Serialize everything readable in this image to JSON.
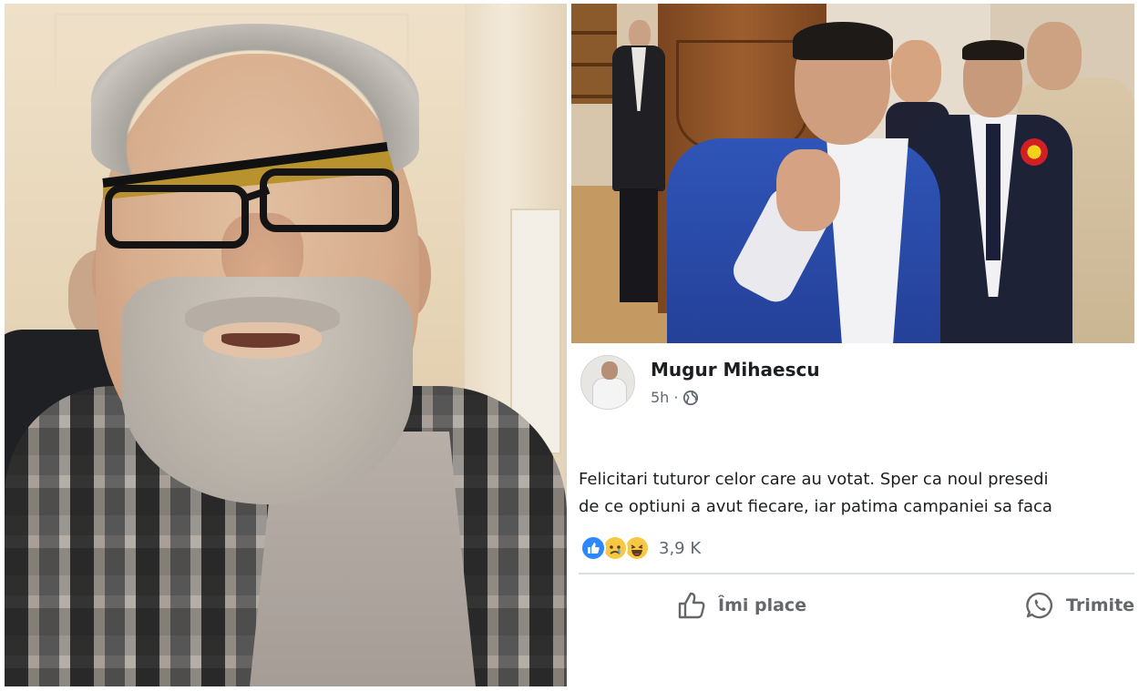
{
  "post": {
    "author": "Mugur Mihaescu",
    "time": "5h",
    "separator": "·",
    "privacy_icon": "globe-icon",
    "text_lines": [
      "Felicitari tuturor celor care au votat. Sper ca noul presedi",
      "de ce optiuni a avut fiecare, iar patima campaniei sa faca"
    ],
    "reactions": {
      "icons": [
        "like-icon",
        "sad-icon",
        "haha-icon"
      ],
      "count": "3,9 K"
    },
    "actions": {
      "like_label": "Îmi place",
      "share_label": "Trimite"
    }
  },
  "colors": {
    "like_blue": "#2d88ff",
    "reaction_yellow": "#f7c843",
    "text_primary": "#1c1e21",
    "text_secondary": "#606770"
  }
}
